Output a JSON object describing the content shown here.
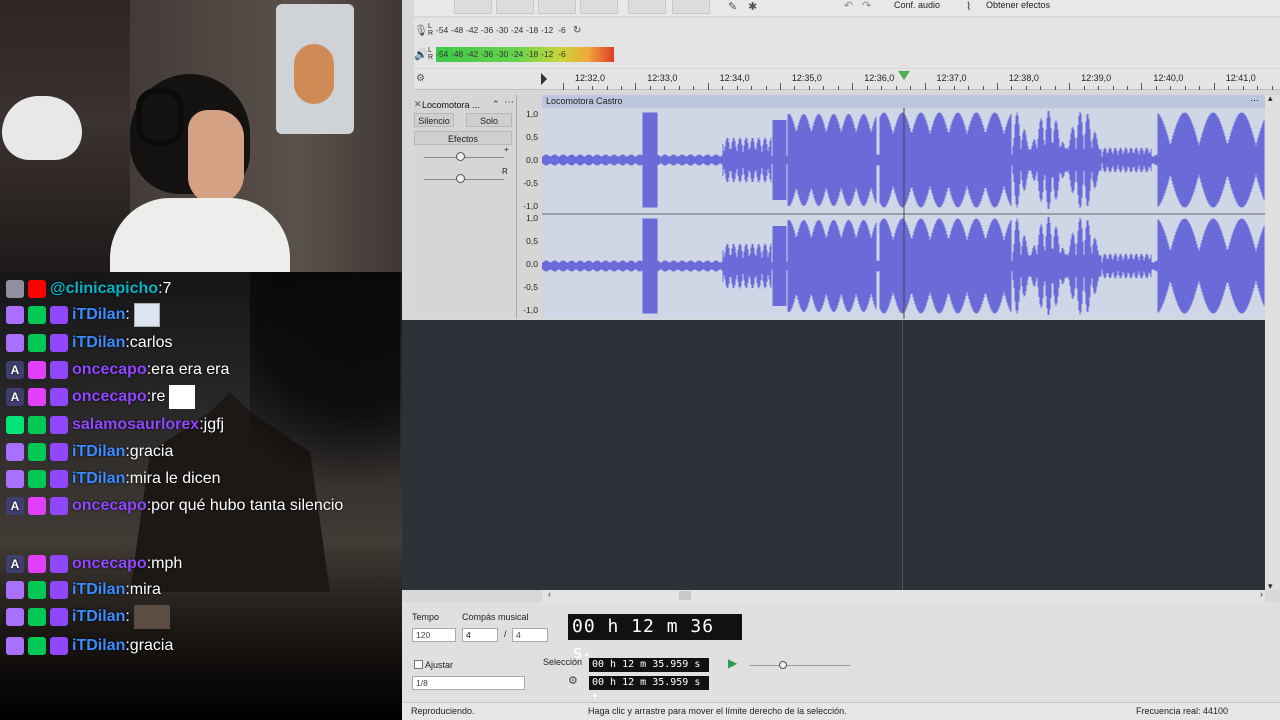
{
  "chat": [
    {
      "user": "@clinicapicho",
      "user_color": "teal",
      "text": "7",
      "badges": [
        "wrench",
        "yt"
      ]
    },
    {
      "user": "iTDilan",
      "user_color": "blue",
      "text": "",
      "badges": [
        "gift",
        "prime",
        "twitch"
      ],
      "image": true
    },
    {
      "user": "iTDilan",
      "user_color": "blue",
      "text": "carlos",
      "badges": [
        "gift",
        "prime",
        "twitch"
      ]
    },
    {
      "user": "oncecapo",
      "user_color": "purple",
      "text": "era era era",
      "badges": [
        "A",
        "heart",
        "twitch"
      ]
    },
    {
      "user": "oncecapo",
      "user_color": "purple",
      "text": "re",
      "badges": [
        "A",
        "heart",
        "twitch"
      ],
      "image2": true
    },
    {
      "user": "salamosaurlorex",
      "user_color": "purple",
      "text": "jgfj",
      "badges": [
        "green2",
        "prime",
        "twitch"
      ]
    },
    {
      "user": "iTDilan",
      "user_color": "blue",
      "text": "gracia",
      "badges": [
        "gift",
        "prime",
        "twitch"
      ]
    },
    {
      "user": "iTDilan",
      "user_color": "blue",
      "text": "mira le dicen",
      "badges": [
        "gift",
        "prime",
        "twitch"
      ]
    },
    {
      "user": "oncecapo",
      "user_color": "purple",
      "text": "por qué hubo tanta silencio",
      "badges": [
        "A",
        "heart",
        "twitch"
      ]
    },
    {
      "user": "oncecapo",
      "user_color": "purple",
      "text": "mph",
      "badges": [
        "A",
        "heart",
        "twitch"
      ]
    },
    {
      "user": "iTDilan",
      "user_color": "blue",
      "text": "mira",
      "badges": [
        "gift",
        "prime",
        "twitch"
      ]
    },
    {
      "user": "iTDilan",
      "user_color": "blue",
      "text": "",
      "badges": [
        "gift",
        "prime",
        "twitch"
      ],
      "image3": true
    },
    {
      "user": "iTDilan",
      "user_color": "blue",
      "text": "gracia",
      "badges": [
        "gift",
        "prime",
        "twitch"
      ]
    }
  ],
  "toolbar": {
    "audio_setup": "Conf. audio",
    "get_effects": "Obtener efectos"
  },
  "meters": {
    "rec_scale": [
      "-54",
      "-48",
      "-42",
      "-36",
      "-30",
      "-24",
      "-18",
      "-12",
      "-6"
    ],
    "play_scale": [
      "-54",
      "-48",
      "-42",
      "-36",
      "-30",
      "-24",
      "-18",
      "-12",
      "-6"
    ],
    "rec_label": "L\nR",
    "play_label": "L\nR"
  },
  "timeline": {
    "ticks": [
      "12:32,0",
      "12:33,0",
      "12:34,0",
      "12:35,0",
      "12:36,0",
      "12:37,0",
      "12:38,0",
      "12:39,0",
      "12:40,0",
      "12:41,0"
    ]
  },
  "track": {
    "name": "Locomotora ...",
    "clip_name": "Locomotora Castro",
    "mute": "Silencio",
    "solo": "Solo",
    "effects": "Efectos",
    "pan_right": "R",
    "scale_top": [
      "1,0",
      "0,5",
      "0,0",
      "-0,5",
      "-1,0"
    ],
    "scale_bottom": [
      "1,0",
      "0,5",
      "0,0",
      "-0,5",
      "-1,0"
    ]
  },
  "bottom": {
    "tempo_label": "Tempo",
    "tempo_value": "120",
    "meter_label": "Compás musical",
    "meter_num": "4",
    "meter_sep": "/",
    "meter_den": "4",
    "time_display": "00 h 12 m 36 s",
    "snap_label": "Ajustar",
    "snap_value": "1/8",
    "selection_label": "Selección",
    "sel_start": "00 h 12 m 35.959 s",
    "sel_end": "00 h 12 m 35.959 s"
  },
  "status": {
    "left": "Reproduciendo.",
    "middle": "Haga clic y arrastre para mover el límite derecho de la selección.",
    "right": "Frecuencia real: 44100"
  },
  "colors": {
    "waveform": "#6a6ad8",
    "wave_bg": "#cfd7e7",
    "playhead": "#4caf50",
    "empty_area": "#2d3138"
  }
}
